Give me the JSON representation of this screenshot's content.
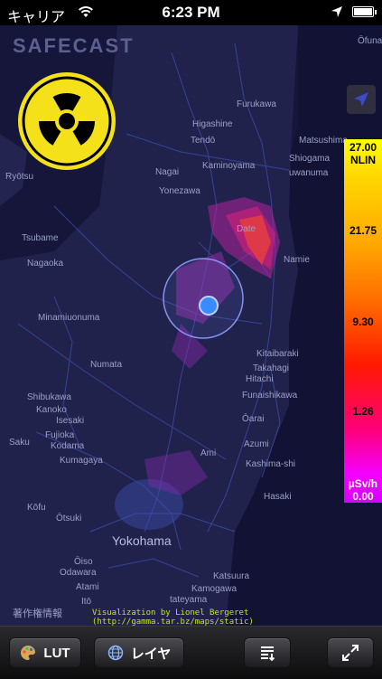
{
  "status": {
    "carrier": "キャリア",
    "time": "6:23 PM",
    "icons": {
      "wifi": "wifi-icon",
      "location": "location-arrow-icon",
      "battery": "battery-icon"
    }
  },
  "map": {
    "brand": "SAFECAST",
    "places": {
      "ofuna": "Ōfuna",
      "matsushima": "Matsushima",
      "shiogama": "Shiogama",
      "kuwanuma": "uwanuma",
      "furukawa": "Furukawa",
      "higashine": "Higashine",
      "tendo": "Tendō",
      "kaminoyama": "Kaminoyama",
      "nagai": "Nagai",
      "yonezawa": "Yonezawa",
      "ryotsu": "Ryōtsu",
      "tsubame": "Tsubame",
      "nagaoka": "Nagaoka",
      "minamiuonuma": "Minamiuonuma",
      "numata": "Numata",
      "kitaibaraki": "Kitaibaraki",
      "takahagi": "Takahagi",
      "hitachi": "Hitachi",
      "funaishikawa": "Funaishikawa",
      "oarai": "Ōarai",
      "kashima": "Kashima-shi",
      "hasaki": "Hasaki",
      "shibukawa": "Shibukawa",
      "kanoko": "Kanoko",
      "isesaki": "Isesaki",
      "fujioka": "Fujioka",
      "kodama": "Kodama",
      "kumagaya": "Kumagaya",
      "saku": "Saku",
      "kofu": "Kōfu",
      "otsuki": "Ōtsuki",
      "yokohama": "Yokohama",
      "oiso": "Ōiso",
      "odawara": "Odawara",
      "atami": "Atami",
      "ito": "Itō",
      "tateyama": "tateyama",
      "katsuura": "Katsuura",
      "kamogawa": "Kamogawa",
      "ami": "Ami",
      "namie": "Namie",
      "date": "Date",
      "azumi": "Azumi"
    }
  },
  "radiation": {
    "icon": "radiation-icon"
  },
  "legend": {
    "max": "27.00",
    "scale": "NLIN",
    "v2": "21.75",
    "v3": "9.30",
    "v4": "1.26",
    "unit": "µSv/h",
    "min": "0.00"
  },
  "copyright": "著作権情報",
  "credit": "Visualization by Lionel Bergeret (http://gamma.tar.bz/maps/static)",
  "toolbar": {
    "lut": "LUT",
    "layers": "レイヤ"
  },
  "colors": {
    "accent": "#f4e11a",
    "credit": "#c8e400",
    "map_bg": "#1c1d45"
  }
}
